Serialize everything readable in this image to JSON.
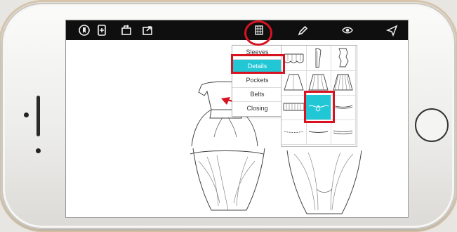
{
  "phone": {
    "toolbar": {
      "left_icons": [
        "bookmark-icon",
        "add-file-icon",
        "export-icon",
        "share-icon"
      ],
      "center_icon": "grid-menu-icon",
      "right_icons": [
        "pencil-icon",
        "eye-icon",
        "send-icon"
      ]
    },
    "menu": {
      "items": [
        {
          "label": "Sleeves",
          "selected": false
        },
        {
          "label": "Details",
          "selected": true
        },
        {
          "label": "Pockets",
          "selected": false
        },
        {
          "label": "Belts",
          "selected": false
        },
        {
          "label": "Closing",
          "selected": false
        }
      ]
    },
    "palette": {
      "selected_index": 7,
      "cell_icons": [
        "skirt-ruffle-icon",
        "sleeve-icon",
        "sleeve-ruffle-icon",
        "skirt-flare-icon",
        "skirt-pleat-icon",
        "skirt-tiered-icon",
        "skirt-ruffle-hem-icon",
        "bow-detail-icon",
        "curve-detail-icon",
        "line-detail-icon",
        "line-detail-icon",
        "line-detail-icon"
      ]
    },
    "highlight_color": "#d8121f",
    "accent_color": "#22c7d6"
  }
}
